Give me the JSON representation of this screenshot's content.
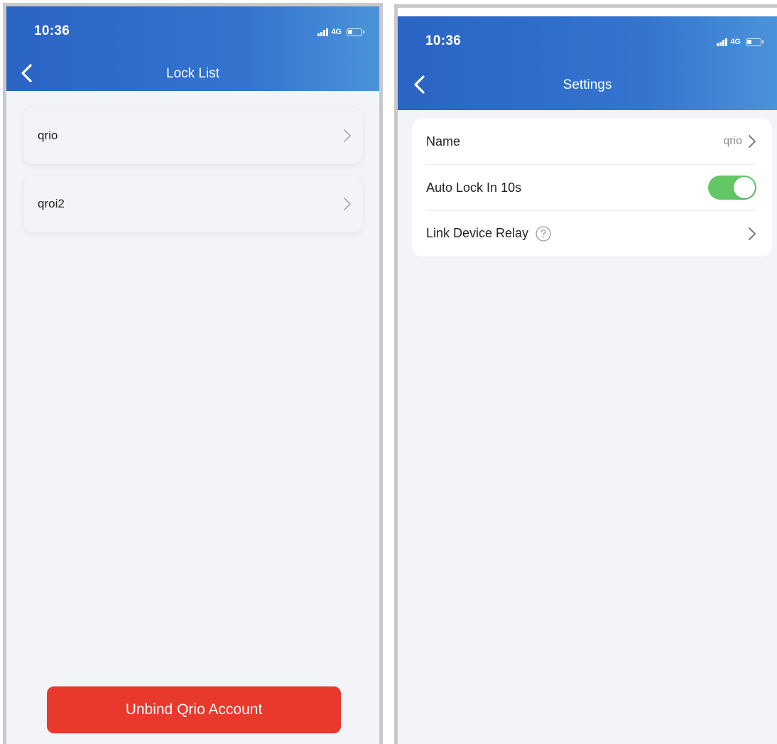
{
  "left_screen": {
    "status_time": "10:36",
    "network": "4G",
    "nav_title": "Lock List",
    "locks": [
      {
        "label": "qrio"
      },
      {
        "label": "qroi2"
      }
    ],
    "unbind_label": "Unbind Qrio Account",
    "colors": {
      "header": "#2f6cc9",
      "button": "#e8392c"
    }
  },
  "right_screen": {
    "status_time": "10:36",
    "network": "4G",
    "nav_title": "Settings",
    "settings": {
      "name_label": "Name",
      "name_value": "qrio",
      "auto_lock_label": "Auto Lock In 10s",
      "auto_lock_on": true,
      "link_relay_label": "Link Device Relay"
    },
    "colors": {
      "toggle_on": "#63c765"
    }
  }
}
